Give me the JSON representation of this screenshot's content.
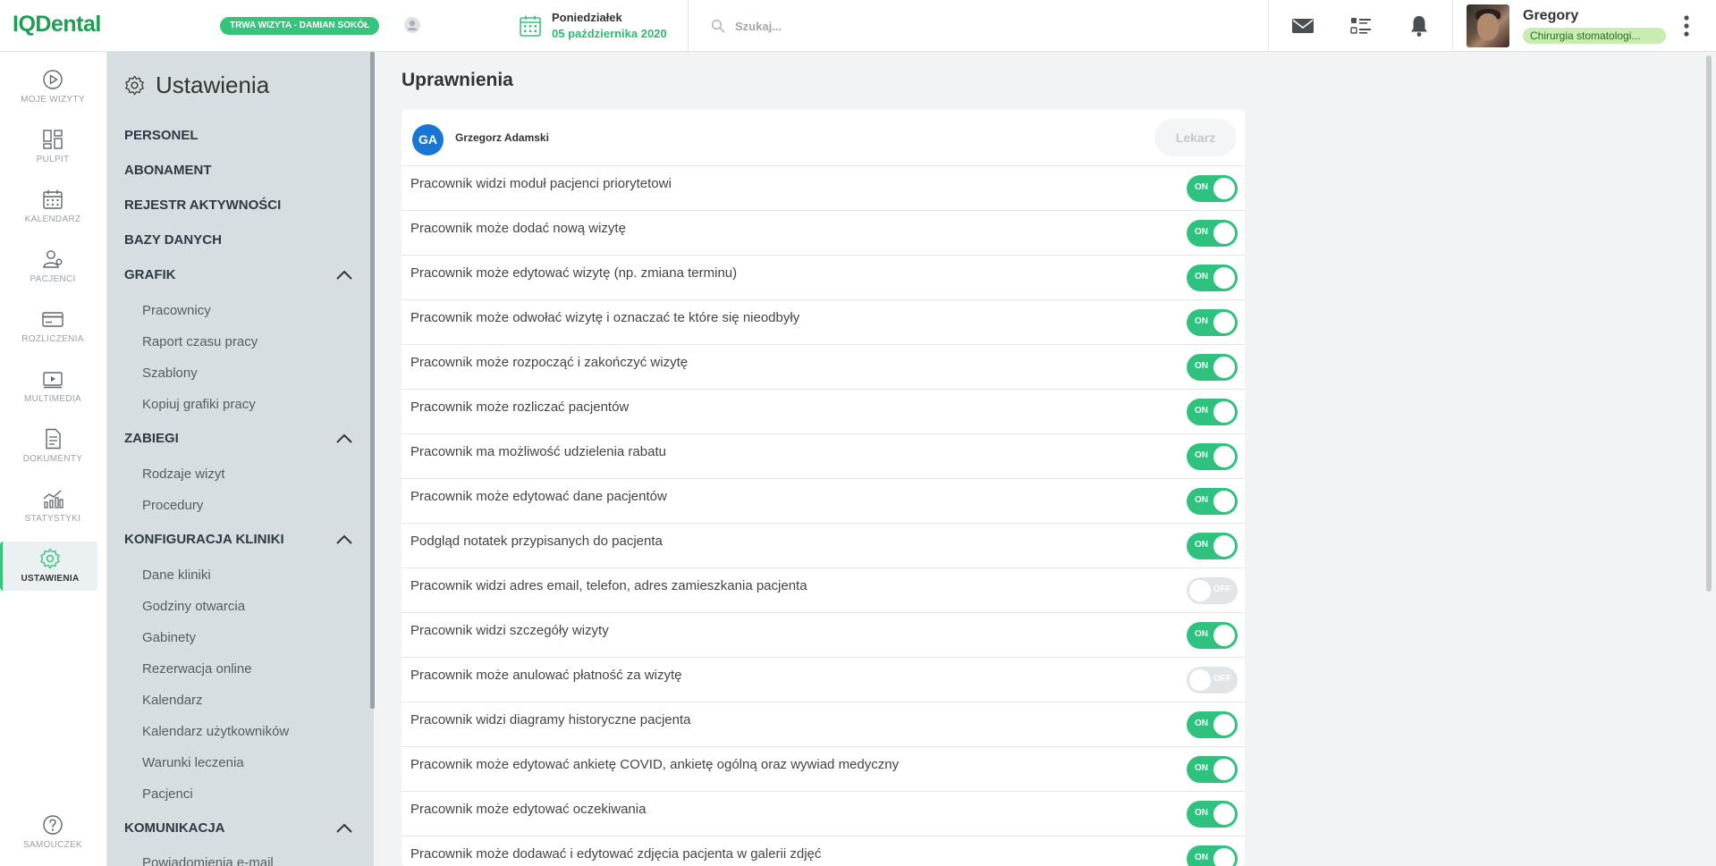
{
  "app": {
    "logo": "IQDental",
    "visit_badge": "TRWA WIZYTA - DAMIAN SOKÓŁ",
    "date_day": "Poniedziałek",
    "date_full": "05 października 2020",
    "search_placeholder": "Szukaj...",
    "user_name": "Gregory",
    "user_role": "Chirurgia stomatologi...",
    "accent_color": "#36c37b",
    "brand_color": "#1e9e55"
  },
  "rail": {
    "items": [
      {
        "label": "MOJE WIZYTY",
        "icon": "play-circle-icon"
      },
      {
        "label": "PULPIT",
        "icon": "dashboard-icon"
      },
      {
        "label": "KALENDARZ",
        "icon": "calendar-icon"
      },
      {
        "label": "PACJENCI",
        "icon": "patients-icon"
      },
      {
        "label": "ROZLICZENIA",
        "icon": "credit-card-icon"
      },
      {
        "label": "MULTIMEDIA",
        "icon": "media-icon"
      },
      {
        "label": "DOKUMENTY",
        "icon": "document-icon"
      },
      {
        "label": "STATYSTYKI",
        "icon": "statistics-icon"
      },
      {
        "label": "USTAWIENIA",
        "icon": "gear-icon",
        "active": true
      }
    ],
    "help_label": "SAMOUCZEK"
  },
  "settings": {
    "title": "Ustawienia",
    "sections": {
      "personel": "PERSONEL",
      "abonament": "ABONAMENT",
      "rejestr": "REJESTR AKTYWNOŚCI",
      "bazy": "BAZY DANYCH",
      "grafik": "GRAFIK",
      "zabiegi": "ZABIEGI",
      "konfiguracja": "KONFIGURACJA KLINIKI",
      "komunikacja": "KOMUNIKACJA"
    },
    "grafik_items": [
      "Pracownicy",
      "Raport czasu pracy",
      "Szablony",
      "Kopiuj grafiki pracy"
    ],
    "zabiegi_items": [
      "Rodzaje wizyt",
      "Procedury"
    ],
    "konfiguracja_items": [
      "Dane kliniki",
      "Godziny otwarcia",
      "Gabinety",
      "Rezerwacja online",
      "Kalendarz",
      "Kalendarz użytkowników",
      "Warunki leczenia",
      "Pacjenci"
    ],
    "komunikacja_items": [
      "Powiadomienia e-mail"
    ]
  },
  "main": {
    "title": "Uprawnienia",
    "employee_initials": "GA",
    "employee_name": "Grzegorz Adamski",
    "role_button": "Lekarz",
    "on_label": "ON",
    "off_label": "OFF",
    "permissions": [
      {
        "label": "Pracownik widzi moduł pacjenci priorytetowi",
        "enabled": true
      },
      {
        "label": "Pracownik może dodać nową wizytę",
        "enabled": true
      },
      {
        "label": "Pracownik może edytować wizytę (np. zmiana terminu)",
        "enabled": true
      },
      {
        "label": "Pracownik może odwołać wizytę i oznaczać te które się nieodbyły",
        "enabled": true
      },
      {
        "label": "Pracownik może rozpocząć i zakończyć wizytę",
        "enabled": true
      },
      {
        "label": "Pracownik może rozliczać pacjentów",
        "enabled": true
      },
      {
        "label": "Pracownik ma możliwość udzielenia rabatu",
        "enabled": true
      },
      {
        "label": "Pracownik może edytować dane pacjentów",
        "enabled": true
      },
      {
        "label": "Podgląd notatek przypisanych do pacjenta",
        "enabled": true
      },
      {
        "label": "Pracownik widzi adres email, telefon, adres zamieszkania pacjenta",
        "enabled": false
      },
      {
        "label": "Pracownik widzi szczegóły wizyty",
        "enabled": true
      },
      {
        "label": "Pracownik może anulować płatność za wizytę",
        "enabled": false
      },
      {
        "label": "Pracownik widzi diagramy historyczne pacjenta",
        "enabled": true
      },
      {
        "label": "Pracownik może edytować ankietę COVID, ankietę ogólną oraz wywiad medyczny",
        "enabled": true
      },
      {
        "label": "Pracownik może edytować oczekiwania",
        "enabled": true
      },
      {
        "label": "Pracownik może dodawać i edytować zdjęcia pacjenta w galerii zdjęć",
        "enabled": true
      }
    ]
  }
}
